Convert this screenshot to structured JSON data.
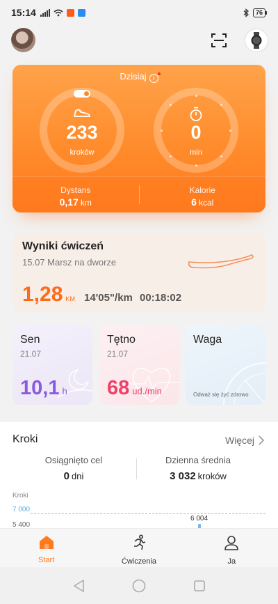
{
  "status_bar": {
    "time": "15:14",
    "battery": "76"
  },
  "colors": {
    "accent": "#ff8a2a",
    "sleep": "#8a5ae0",
    "heart": "#f0406a",
    "distance": "#ff6a1a"
  },
  "today": {
    "title": "Dzisiaj",
    "steps_value": "233",
    "steps_unit": "kroków",
    "minutes_value": "0",
    "minutes_unit": "min",
    "distance_label": "Dystans",
    "distance_value": "0,17",
    "distance_unit": "km",
    "calories_label": "Kalorie",
    "calories_value": "6",
    "calories_unit": "kcal"
  },
  "exercise": {
    "title": "Wyniki ćwiczeń",
    "subtitle": "15.07  Marsz na dworze",
    "distance": "1,28",
    "distance_unit": "KM",
    "pace": "14'05\"/km",
    "duration": "00:18:02"
  },
  "cards": {
    "sleep": {
      "title": "Sen",
      "date": "21.07",
      "value": "10,1",
      "unit": "h"
    },
    "heart": {
      "title": "Tętno",
      "date": "21.07",
      "value": "68",
      "unit": "ud./min"
    },
    "weight": {
      "title": "Waga",
      "motto": "Odważ się żyć zdrowo"
    }
  },
  "steps_section": {
    "title": "Kroki",
    "more_label": "Więcej",
    "goal_label": "Osiągnięto cel",
    "goal_value": "0",
    "goal_unit": "dni",
    "avg_label": "Dzienna średnia",
    "avg_value": "3 032",
    "avg_unit": "kroków",
    "chart_ylabel": "Kroki",
    "tick_goal": "7 000",
    "tick_low": "5 400",
    "bar_label": "6 004"
  },
  "bottom_nav": {
    "start": "Start",
    "exercises": "Ćwiczenia",
    "me": "Ja"
  },
  "icons": [
    "wifi-icon",
    "signal-icon",
    "bluetooth-icon",
    "scan-icon",
    "watch-icon",
    "shoe-icon",
    "stopwatch-icon",
    "info-icon",
    "chevron-right-icon",
    "home-icon",
    "runner-icon",
    "person-icon",
    "back-icon",
    "home-circle-icon",
    "recents-icon"
  ]
}
